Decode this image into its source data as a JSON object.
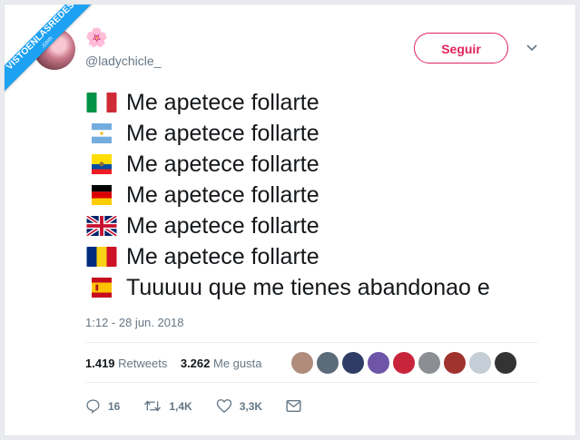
{
  "ribbon": {
    "main": "VISTOENLASREDES",
    "sub": ".com"
  },
  "user": {
    "emoji": "🌸",
    "handle": "@ladychicle_"
  },
  "follow_label": "Seguir",
  "lines": [
    {
      "flag": "italy",
      "text": "Me apetece follarte"
    },
    {
      "flag": "argentina",
      "text": "Me apetece follarte"
    },
    {
      "flag": "ecuador",
      "text": "Me apetece follarte"
    },
    {
      "flag": "germany",
      "text": "Me apetece follarte"
    },
    {
      "flag": "uk",
      "text": "Me apetece follarte"
    },
    {
      "flag": "romania",
      "text": "Me apetece follarte"
    },
    {
      "flag": "spain",
      "text": "Tuuuuu que me tienes abandonao e"
    }
  ],
  "timestamp": "1:12 - 28 jun. 2018",
  "stats": {
    "retweets_count": "1.419",
    "retweets_label": "Retweets",
    "likes_count": "3.262",
    "likes_label": "Me gusta"
  },
  "actions": {
    "replies": "16",
    "retweets": "1,4K",
    "likes": "3,3K"
  },
  "colors": {
    "accent": "#e0245e",
    "ribbon": "#1da1f2",
    "text": "#14171a",
    "muted": "#657786"
  }
}
